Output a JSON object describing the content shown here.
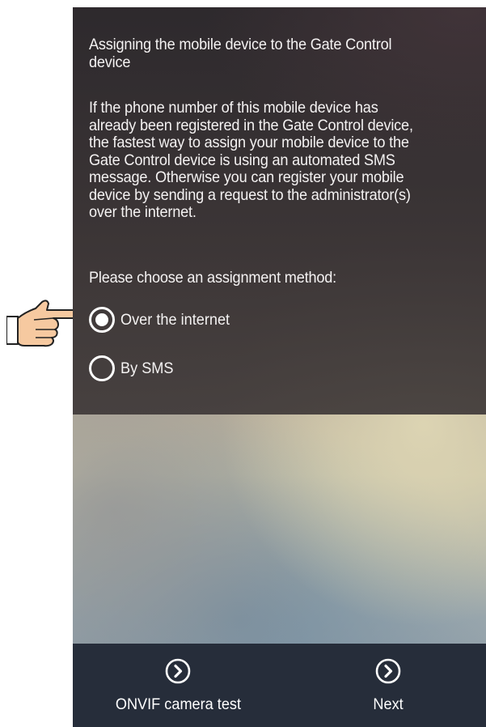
{
  "dialog": {
    "title": "Assigning the mobile device to the Gate Control\ndevice",
    "body": "If the phone number of this mobile device has\nalready been registered in the Gate Control device,\nthe fastest way to assign your mobile device to the\nGate Control device is using an automated SMS\nmessage. Otherwise you can register your mobile\ndevice by sending a request to the administrator(s)\nover the internet.",
    "prompt": "Please choose an assignment method:",
    "options": [
      {
        "label": "Over the internet",
        "selected": true
      },
      {
        "label": "By SMS",
        "selected": false
      }
    ]
  },
  "bottom_bar": {
    "left_button": {
      "label": "ONVIF camera test",
      "icon": "chevron-right-circle-icon"
    },
    "right_button": {
      "label": "Next",
      "icon": "chevron-right-circle-icon"
    }
  },
  "annotation": {
    "icon": "pointing-hand-icon"
  },
  "colors": {
    "panel": "#2e2a2d",
    "bottom_bar": "#262d3a",
    "text": "#ffffff",
    "hand_skin": "#f6c9a0"
  }
}
